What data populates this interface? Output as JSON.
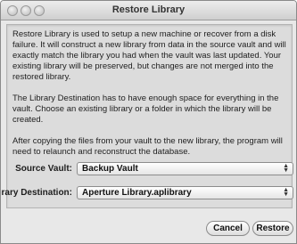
{
  "window": {
    "title": "Restore Library"
  },
  "description": {
    "paragraph1": "Restore Library is used to setup a new machine or recover from a disk failure.  It will construct a new library from data in the source vault and will exactly match the library you had when the vault was last updated. Your existing library will be preserved, but changes are not merged into the restored library.",
    "paragraph2": "The Library Destination has to have enough space for everything in the vault.  Choose an existing library or a folder in which the library will be created.",
    "paragraph3": "After copying the files from your vault to the new library, the program will need to relaunch and reconstruct the database."
  },
  "form": {
    "source_label": "Source Vault:",
    "source_value": "Backup Vault",
    "destination_label": "Library Destination:",
    "destination_value": "Aperture Library.aplibrary"
  },
  "buttons": {
    "cancel": "Cancel",
    "restore": "Restore"
  }
}
